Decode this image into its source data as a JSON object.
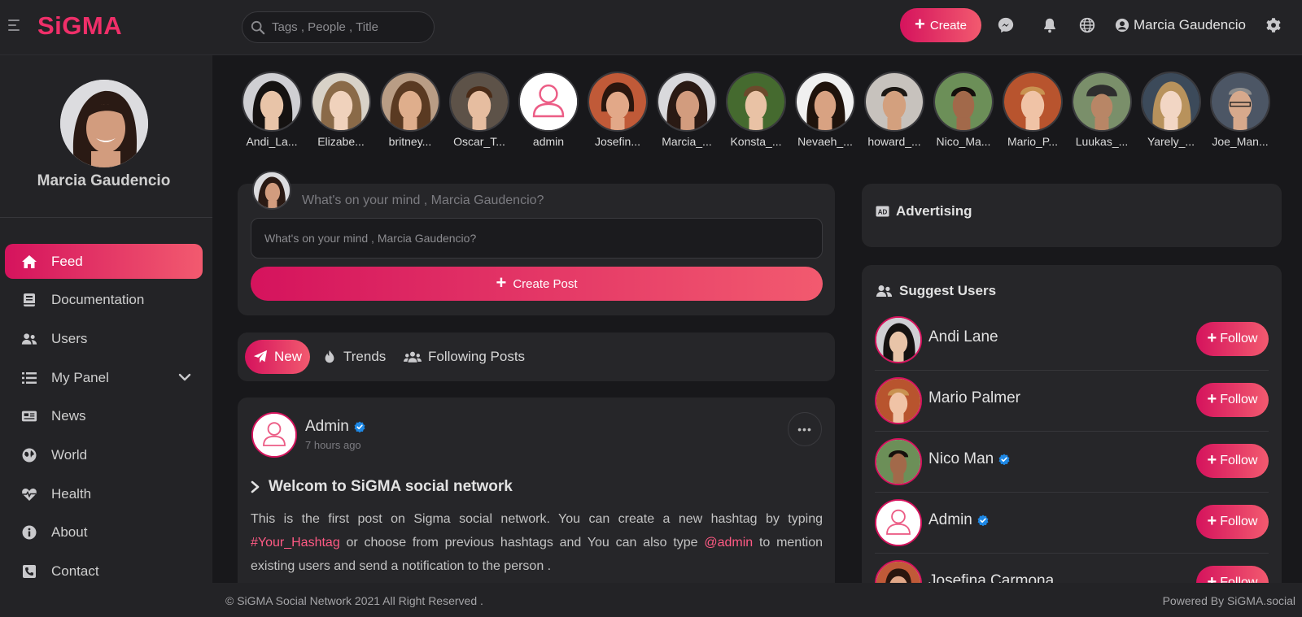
{
  "colors": {
    "accent": "#ef2f69",
    "accent_grad_start": "#d5135d",
    "accent_grad_end": "#f25a6f",
    "bg": "#18181b",
    "card": "#262629",
    "verified": "#1e88e5"
  },
  "topbar": {
    "logo": "SiGMA",
    "search_placeholder": "Tags , People , Title",
    "create_label": "Create",
    "icons": [
      "messenger-icon",
      "bell-icon",
      "globe-icon",
      "gear-icon"
    ],
    "user_name": "Marcia Gaudencio"
  },
  "sidebar": {
    "profile_name": "Marcia Gaudencio",
    "items": [
      {
        "label": "Feed",
        "icon": "home-icon",
        "active": true
      },
      {
        "label": "Documentation",
        "icon": "book-icon"
      },
      {
        "label": "Users",
        "icon": "users-icon"
      },
      {
        "label": "My Panel",
        "icon": "list-icon",
        "has_dropdown": true
      },
      {
        "label": "News",
        "icon": "newspaper-icon"
      },
      {
        "label": "World",
        "icon": "globe-icon"
      },
      {
        "label": "Health",
        "icon": "heartbeat-icon"
      },
      {
        "label": "About",
        "icon": "info-icon"
      },
      {
        "label": "Contact",
        "icon": "phone-icon"
      }
    ]
  },
  "stories": [
    "Andi_La...",
    "Elizabe...",
    "britney...",
    "Oscar_T...",
    "admin",
    "Josefin...",
    "Marcia_...",
    "Konsta_...",
    "Nevaeh_...",
    "howard_...",
    "Nico_Ma...",
    "Mario_P...",
    "Luukas_...",
    "Yarely_...",
    "Joe_Man..."
  ],
  "composer": {
    "prompt": "What's on your mind , Marcia Gaudencio?",
    "input_placeholder": "What's on your mind , Marcia Gaudencio?",
    "button_label": "Create Post"
  },
  "tabs": [
    {
      "label": "New",
      "icon": "paper-plane-icon",
      "active": true
    },
    {
      "label": "Trends",
      "icon": "fire-icon"
    },
    {
      "label": "Following Posts",
      "icon": "users-icon"
    }
  ],
  "post": {
    "author": "Admin",
    "time": "7 hours ago",
    "menu": "•••",
    "title": "Welcom to SiGMA social network",
    "body_1": "This is the first post on Sigma social network. You can create a new hashtag by typing ",
    "hashtag": "#Your_Hashtag",
    "body_2": " or choose from previous hashtags and You can also type ",
    "mention": "@admin",
    "body_3": " to mention existing users and send a notification to the person ."
  },
  "right": {
    "ad_title": "Advertising",
    "suggest_title": "Suggest Users",
    "follow_label": "Follow",
    "suggested": [
      {
        "name": "Andi Lane",
        "verified": false
      },
      {
        "name": "Mario Palmer",
        "verified": false
      },
      {
        "name": "Nico Man",
        "verified": true
      },
      {
        "name": "Admin",
        "verified": true
      },
      {
        "name": "Josefina Carmona",
        "verified": false
      }
    ]
  },
  "footer": {
    "copyright": "© SiGMA Social Network 2021 All Right Reserved .",
    "powered": "Powered By SiGMA.social"
  }
}
